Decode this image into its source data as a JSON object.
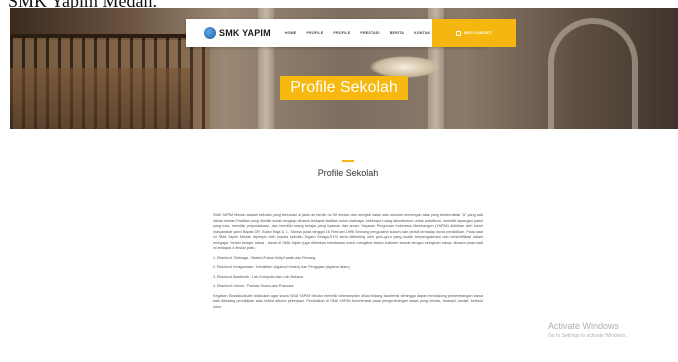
{
  "caption": "SMK Yapim Medan.",
  "navbar": {
    "brand": "SMK YAPIM",
    "links": [
      "HOME",
      "PROFILE",
      "PROFILE",
      "PRESTASI",
      "BERITA",
      "KONTAK"
    ],
    "cta_label": "INFO CONTACT"
  },
  "hero": {
    "title": "Profile Sekolah"
  },
  "section": {
    "title": "Profile Sekolah"
  },
  "content": {
    "intro": "SMA YAPIM Medan adalah sekolah yang berlokasi di jalan air bersih no 50 medan dan menjadi salah satu sekolah menengah atas yang terakreditasi \"A\" yang ada dikota medan.Fasilitas yang dimiliki sudah lengkap dimana terdapat fasilitas untuk olahraga, beberapa ruang laboratorium untuk praktikum, memiliki lapangan parkir yang luas, memiliki perpustakaan, dan memiliki ruang belajar yang nyaman dan aman. Yayasan Perguruan Indonesia Membangun (YAPIM) didirikan oleh tokoh masyarakat yakni Bapak DR. Sutan Raja D. L. Sitorus pada tanggal 16 Februari 1996 Seorang pengusaha sukses dan peduli terhadap dunia pendidikan. Pada saat ini SMA Yapim Medan dipimpin oleh kepala sekolah Togam Sinaga,S.Pd serta dibimbing oleh guru-guru yang sudah berpengalaman dan bersertifikasi dalam mengajar. Selain belajar, siswa - siswa di SMA Yapim juga diberikan kebebasan untuk mengikuti ekstra kulikuler sesuai dengan keinginan siswa, dimana pada saat ini terdapat 4 ekskul yaitu :",
    "items": [
      "1. Ekschool Olahraga : Basket,Futsal,Volly,Karate,dan Renang",
      "2. Ekschool Keagamaan : Kebaktian (Agama Kristen),dan Pengajian (Agama Islam)",
      "3. Ekschool Akademik : Lab Komputer,dan Lab Bahasa",
      "4. Ekschool Umum : Paduan Suara,dan Pramuka"
    ],
    "closing": "Kegiatan Ekstrakulikuler dilakukan agar siswa SMA YAPIM Medan memiliki keterampilan diluar bidang akademik sehingga dapat mendukung perkembangan siswa baik dibidang pendidikan atau ketika dibuna pekerjaan. Pendidikan di SMA YAPIM berorientasi pada pengembangan siswa yang cerdas, terampil, kreatif, berbudi luhur"
  },
  "watermark": {
    "title": "Activate Windows",
    "subtitle": "Go to Settings to activate Windows."
  },
  "colors": {
    "accent": "#f5b70f",
    "brand_blue": "#1d5c9c"
  }
}
